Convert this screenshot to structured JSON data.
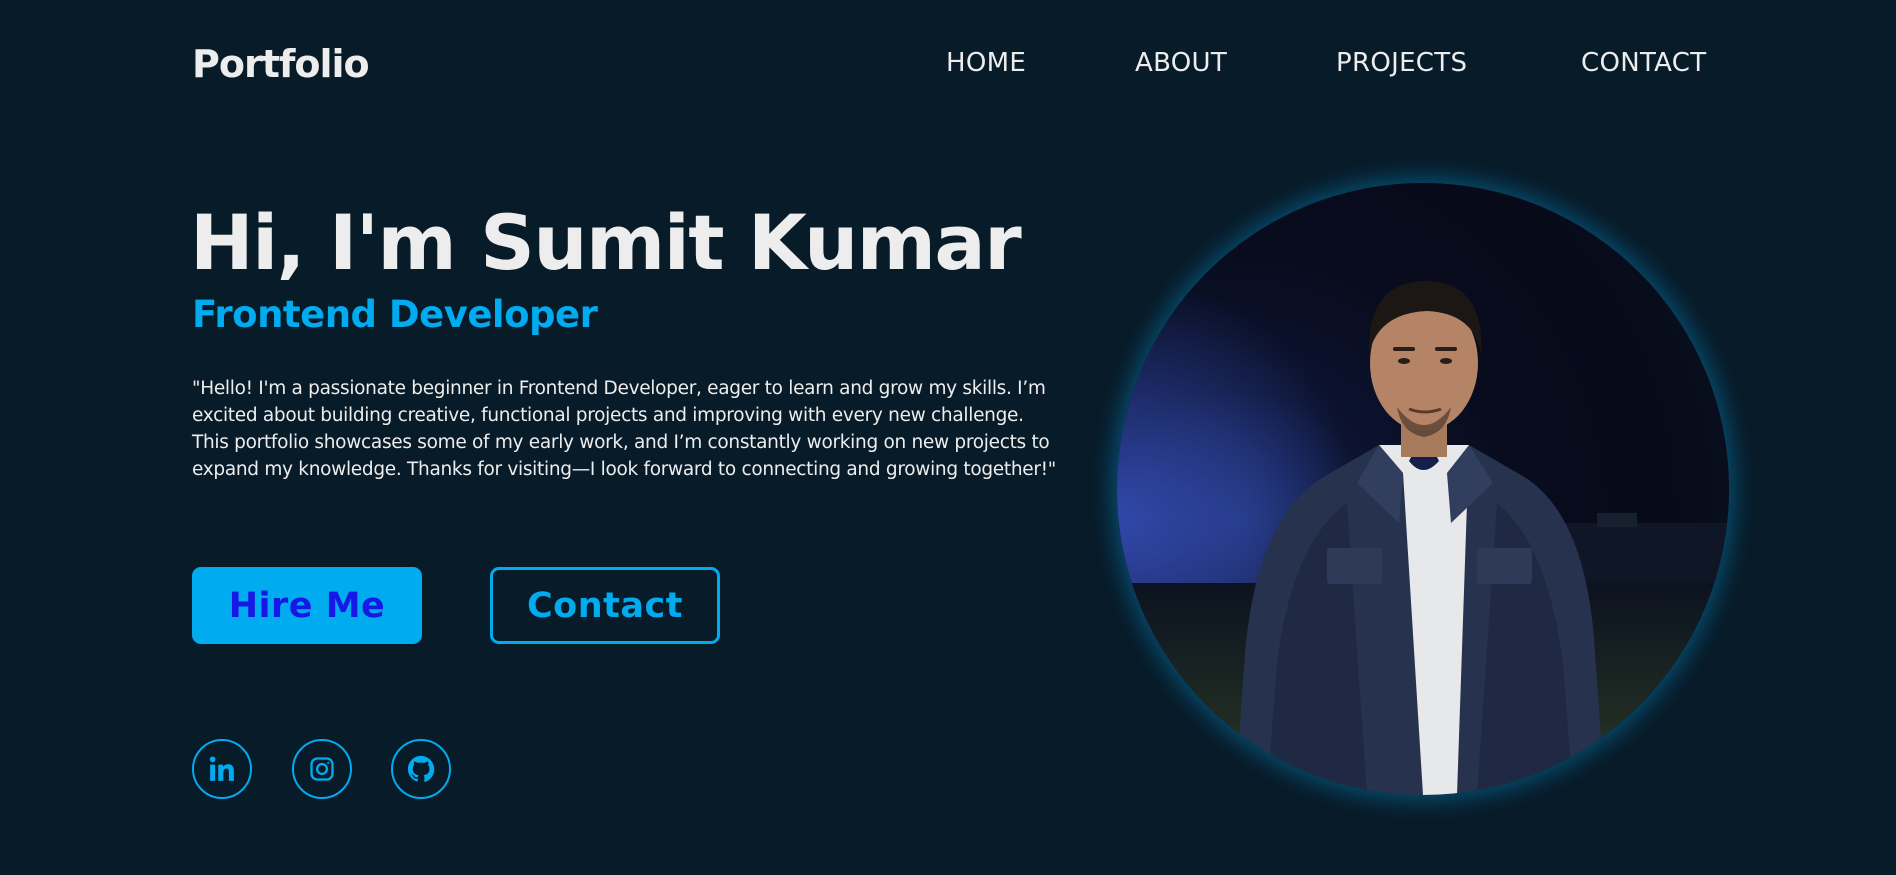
{
  "header": {
    "logo": "Portfolio",
    "nav": [
      "HOME",
      "ABOUT",
      "PROJECTS",
      "CONTACT"
    ]
  },
  "hero": {
    "title": "Hi, I'm Sumit Kumar",
    "subtitle": "Frontend Developer",
    "description": "\"Hello! I'm a passionate beginner in Frontend Developer, eager to learn and grow my skills. I’m excited about building creative, functional projects and improving with every new challenge. This portfolio showcases some of my early work, and I’m constantly working on new projects to expand my knowledge. Thanks for visiting—I look forward to connecting and growing together!\"",
    "buttons": {
      "hire": "Hire Me",
      "contact": "Contact"
    }
  },
  "social": [
    {
      "icon": "linkedin-icon"
    },
    {
      "icon": "instagram-icon"
    },
    {
      "icon": "github-icon"
    }
  ],
  "colors": {
    "background": "#081b29",
    "accent": "#00abf0",
    "text": "#ededed",
    "hire_text": "#1717e6"
  }
}
